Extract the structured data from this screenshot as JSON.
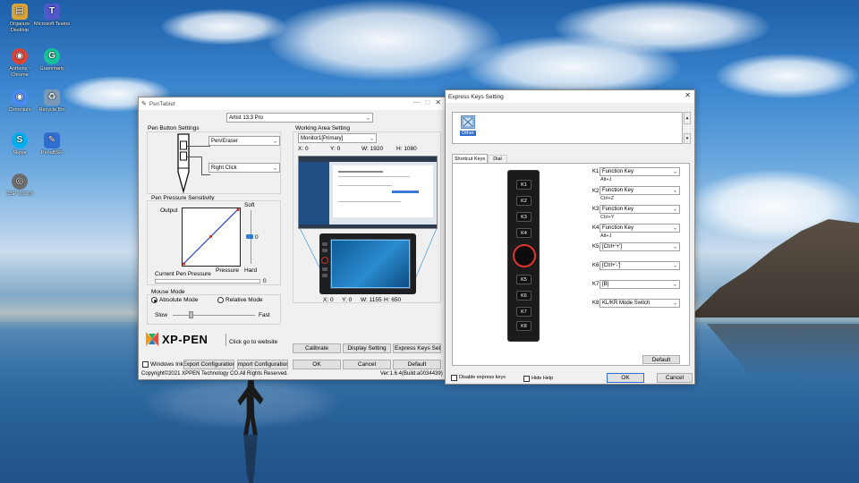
{
  "desktop": {
    "icons": [
      {
        "label": "Organize Desktop",
        "glyph": "▤",
        "color": "#d9a53a"
      },
      {
        "label": "Microsoft Teams",
        "glyph": "T",
        "color": "#5059c9"
      },
      {
        "label": "Anthony - Chrome",
        "glyph": "◉",
        "color": "#db4437"
      },
      {
        "label": "Grammarly",
        "glyph": "G",
        "color": "#15c39a"
      },
      {
        "label": "Chromium",
        "glyph": "◉",
        "color": "#4a8af4"
      },
      {
        "label": "Recycle Bin",
        "glyph": "♻",
        "color": "#7a9ab8"
      },
      {
        "label": "Skype",
        "glyph": "S",
        "color": "#00aff0"
      },
      {
        "label": "PenaBSR",
        "glyph": "✎",
        "color": "#2f6fd1"
      },
      {
        "label": "CSP 2.0.0.0",
        "glyph": "◎",
        "color": "#6e6e6e"
      }
    ]
  },
  "pentablet": {
    "title": "PenTablet",
    "device": "Artist 13.3 Pro",
    "pen_button_settings": {
      "heading": "Pen Button Settings",
      "button1": "Pen/Eraser",
      "button2": "Right Click"
    },
    "pressure": {
      "heading": "Pen Pressure Sensitivity",
      "output_label": "Output",
      "pressure_label": "Pressure",
      "soft_label": "Soft",
      "hard_label": "Hard",
      "slider_value": "0",
      "current_label": "Current Pen Pressure",
      "current_value": "0"
    },
    "mouse_mode": {
      "heading": "Mouse Mode",
      "absolute": "Absolute Mode",
      "relative": "Relative Mode",
      "slow": "Slow",
      "fast": "Fast"
    },
    "working_area": {
      "heading": "Working Area Setting",
      "monitor": "Monitor1[Primary]",
      "x_label": "X:",
      "x_val": "0",
      "y_label": "Y:",
      "y_val": "0",
      "w_label": "W:",
      "w_val": "1920",
      "h_label": "H:",
      "h_val": "1080",
      "tx_label": "X:",
      "tx_val": "0",
      "ty_label": "Y:",
      "ty_val": "0",
      "tw_label": "W:",
      "tw_val": "1155",
      "th_label": "H:",
      "th_val": "650"
    },
    "logo_text": "XP-PEN",
    "website_link": "Click go to website",
    "buttons": {
      "calibrate": "Calibrate",
      "display": "Display Setting",
      "express": "Express Keys Setting",
      "ok": "OK",
      "cancel": "Cancel",
      "default": "Default",
      "export": "Export Configuration",
      "import": "Import Configuration"
    },
    "windows_ink": "Windows Ink",
    "copyright": "Copyright©2021 XPPEN Technology CO.All Rights Reserved.",
    "version": "Ver:1.6.4(Build:a0034439)"
  },
  "express": {
    "title": "Express Keys Setting",
    "app_label": "Other",
    "tabs": [
      "Shortcut Keys",
      "Dial"
    ],
    "device_keys": [
      "K1",
      "K2",
      "K3",
      "K4",
      "K5",
      "K6",
      "K7",
      "K8"
    ],
    "rows": [
      {
        "key": "K1",
        "value": "Function Key",
        "sub": "Alt+J"
      },
      {
        "key": "K2",
        "value": "Function Key",
        "sub": "Ctrl+Z"
      },
      {
        "key": "K3",
        "value": "Function Key",
        "sub": "Ctrl+Y"
      },
      {
        "key": "K4",
        "value": "Function Key",
        "sub": "Alt+J"
      },
      {
        "key": "K5",
        "value": "[Ctrl+'+']",
        "sub": ""
      },
      {
        "key": "K6",
        "value": "[Ctrl+'-']",
        "sub": ""
      },
      {
        "key": "K7",
        "value": "[B]",
        "sub": ""
      },
      {
        "key": "K8",
        "value": "KL/KR Mode Switch",
        "sub": ""
      }
    ],
    "default_btn": "Default",
    "disable_label": "Disable express keys",
    "hide_help": "Hide Help",
    "ok": "OK",
    "cancel": "Cancel"
  }
}
